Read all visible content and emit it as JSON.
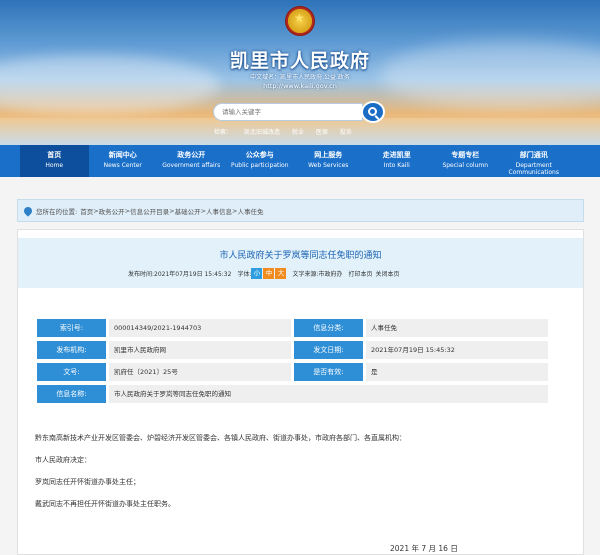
{
  "header": {
    "site_title": "凯里市人民政府",
    "site_subtitle": "中文域名：凯里市人民政府.公益.政务",
    "site_url": "http://www.kaili.gov.cn",
    "search_placeholder": "请输入关键字",
    "hot_links": [
      "检索：",
      "凯北旧城改造",
      "就业",
      "医保",
      "投诉"
    ]
  },
  "nav": {
    "items": [
      {
        "cn": "首页",
        "en": "Home"
      },
      {
        "cn": "新闻中心",
        "en": "News Center"
      },
      {
        "cn": "政务公开",
        "en": "Government affairs"
      },
      {
        "cn": "公众参与",
        "en": "Public participation"
      },
      {
        "cn": "网上服务",
        "en": "Web Services"
      },
      {
        "cn": "走进凯里",
        "en": "Into Kaili"
      },
      {
        "cn": "专题专栏",
        "en": "Special column"
      },
      {
        "cn": "部门通讯",
        "en": "Department Communications"
      }
    ]
  },
  "breadcrumb": {
    "prefix": "您所在的位置:",
    "items": [
      "首页",
      "政务公开",
      "信息公开目录",
      "基础公开",
      "人事信息",
      "人事任免"
    ],
    "separator": " > "
  },
  "article": {
    "title": "市人民政府关于罗岚等同志任免职的通知",
    "publish_time_label": "发布时间:",
    "publish_time": "2021年07月19日 15:45:32",
    "font_size_label": "字体:",
    "font_sizes": [
      "小",
      "中",
      "大"
    ],
    "source_label": "文字来源:",
    "source": "市政府办",
    "print_label": "打印本页",
    "close_label": "关闭本页"
  },
  "info": {
    "index_no_label": "索引号:",
    "index_no": "000014349/2021-1944703",
    "category_label": "信息分类:",
    "category": "人事任免",
    "issuer_label": "发布机构:",
    "issuer": "凯里市人民政府网",
    "date_label": "发文日期:",
    "date": "2021年07月19日 15:45:32",
    "doc_no_label": "文号:",
    "doc_no": "凯府任〔2021〕25号",
    "valid_label": "是否有效:",
    "valid": "是",
    "name_label": "信息名称:",
    "name": "市人民政府关于罗岚等同志任免职的通知"
  },
  "body": {
    "recipients": "黔东南高新技术产业开发区管委会、炉碧经济开发区管委会、各镇人民政府、街道办事处，市政府各部门、各直属机构：",
    "p1": "市人民政府决定：",
    "p2": "罗岚同志任开怀街道办事处主任；",
    "p3": "戴武同志不再担任开怀街道办事处主任职务。",
    "sign_date": "2021 年 7 月 16 日"
  }
}
